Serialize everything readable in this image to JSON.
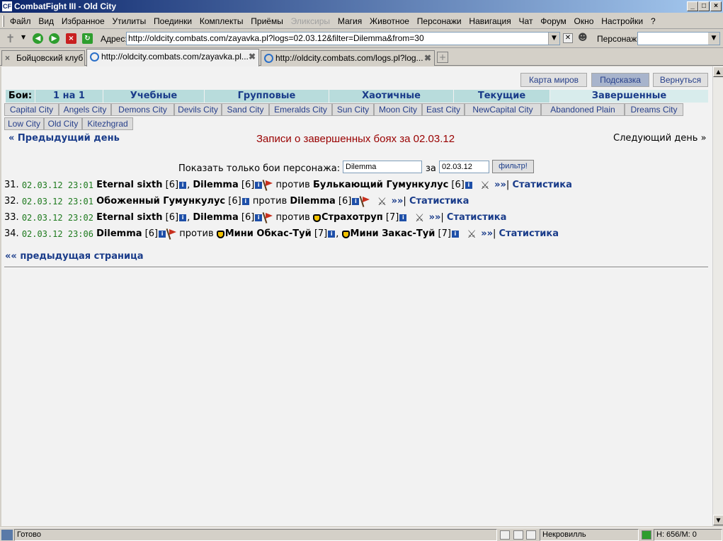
{
  "window": {
    "title": "CombatFight III - Old City",
    "app_icon": "CF"
  },
  "menu": [
    "Файл",
    "Вид",
    "Избранное",
    "Утилиты",
    "Поединки",
    "Комплекты",
    "Приёмы",
    "Эликсиры",
    "Магия",
    "Животное",
    "Персонажи",
    "Навигация",
    "Чат",
    "Форум",
    "Окно",
    "Настройки",
    "?"
  ],
  "menu_disabled_index": 7,
  "address": {
    "label": "Адрес:",
    "url": "http://oldcity.combats.com/zayavka.pl?logs=02.03.12&filter=Dilemma&from=30"
  },
  "persona": {
    "label": "Персонаж:",
    "value": ""
  },
  "tabs": [
    {
      "label": "Бойцовский клуб"
    },
    {
      "label": "http://oldcity.combats.com/zayavka.pl..."
    },
    {
      "label": "http://oldcity.combats.com/logs.pl?log..."
    }
  ],
  "top_buttons": {
    "map": "Карта миров",
    "hint": "Подсказка",
    "back": "Вернуться"
  },
  "fight_tabs": {
    "label": "Бои:",
    "items": [
      "1 на 1",
      "Учебные",
      "Групповые",
      "Хаотичные",
      "Текущие",
      "Завершенные"
    ]
  },
  "cities_row1": [
    "Capital City",
    "Angels City",
    "Demons City",
    "Devils City",
    "Sand City",
    "Emeralds City",
    "Sun City",
    "Moon City",
    "East City",
    "NewCapital City",
    "Abandoned Plain",
    "Dreams City"
  ],
  "cities_row2": [
    "Low City",
    "Old City",
    "Kitezhgrad"
  ],
  "nav": {
    "prev_day": "« Предыдущий день",
    "heading": "Записи о завершенных боях за 02.03.12",
    "next_day": "Следующий день »"
  },
  "filter": {
    "label": "Показать только бои персонажа:",
    "name": "Dilemma",
    "za": "за",
    "date": "02.03.12",
    "button": "фильтр!"
  },
  "battles": [
    {
      "num": "31.",
      "datetime": "02.03.12 23:01",
      "vs": "против",
      "stats": "Статистика"
    },
    {
      "num": "32.",
      "datetime": "02.03.12 23:01",
      "vs": "против",
      "stats": "Статистика"
    },
    {
      "num": "33.",
      "datetime": "02.03.12 23:02",
      "vs": "против",
      "stats": "Статистика"
    },
    {
      "num": "34.",
      "datetime": "02.03.12 23:06",
      "vs": "против",
      "stats": "Статистика"
    }
  ],
  "players": {
    "eternal_sixth": "Eternal sixth",
    "dilemma": "Dilemma",
    "bulkayushchiy": "Булькающий Гумункулус",
    "obozhenniy": "Обоженный Гумункулус",
    "strakhotrup": "Страхотруп",
    "mini_obkas": "Мини Обкас-Туй",
    "mini_zakas": "Мини Закас-Туй",
    "lvl6": "[6]",
    "lvl7": "[7]"
  },
  "log_link": "»»",
  "prev_page": "«« предыдущая страница",
  "status": {
    "ready": "Готово",
    "location": "Некровилль",
    "hm": "Н: 656/М: 0"
  },
  "icons": [
    "app-icon",
    "back-icon",
    "forward-icon",
    "stop-icon",
    "refresh-icon",
    "info-icon",
    "flag-icon",
    "bot-icon",
    "swords-icon"
  ],
  "colors": {
    "heading": "#990000",
    "link": "#1a3c8a",
    "datetime": "#1e7a1e",
    "tabs_bg": "#b8dcdc"
  }
}
